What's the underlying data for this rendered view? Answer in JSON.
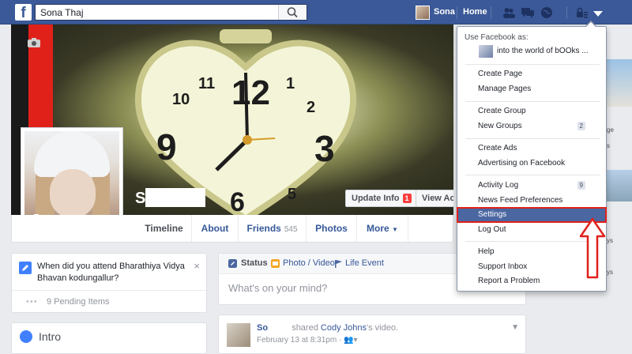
{
  "topbar": {
    "logo": "f",
    "search_value": "Sona Thaj",
    "profile_name": "Sona",
    "home_label": "Home"
  },
  "profile": {
    "name_initial": "S"
  },
  "cover_buttons": {
    "update_info": "Update Info",
    "update_info_badge": "1",
    "view_activity": "View Activi"
  },
  "tabs": [
    {
      "label": "Timeline"
    },
    {
      "label": "About"
    },
    {
      "label": "Friends",
      "count": "545"
    },
    {
      "label": "Photos"
    },
    {
      "label": "More"
    }
  ],
  "reminder": {
    "text": "When did you attend Bharathiya Vidya Bhavan kodungallur?",
    "pending": "9 Pending Items",
    "close": "×"
  },
  "intro": {
    "label": "Intro"
  },
  "composer": {
    "status": "Status",
    "photo_video": "Photo / Video",
    "life_event": "Life Event",
    "placeholder": "What's on your mind?"
  },
  "post": {
    "author": "So",
    "action": "shared",
    "shared_from": "Cody Johns",
    "object": "'s video.",
    "date": "February 13 at 8:31pm ·"
  },
  "right_peek": {
    "texts": [
      "ge",
      "s",
      "ys",
      "ys"
    ]
  },
  "dropdown": {
    "use_as": "Use Facebook as:",
    "page_name": "into the world of bOOks ...",
    "items": [
      {
        "label": "Create Page"
      },
      {
        "label": "Manage Pages"
      },
      {
        "label": "Create Group"
      },
      {
        "label": "New Groups",
        "badge": "2"
      },
      {
        "label": "Create Ads"
      },
      {
        "label": "Advertising on Facebook"
      },
      {
        "label": "Activity Log",
        "badge": "9"
      },
      {
        "label": "News Feed Preferences"
      },
      {
        "label": "Settings"
      },
      {
        "label": "Log Out"
      },
      {
        "label": "Help"
      },
      {
        "label": "Support Inbox"
      },
      {
        "label": "Report a Problem"
      }
    ]
  },
  "colors": {
    "brand": "#3b5998",
    "highlight": "#4b67a1",
    "annotation_red": "#e0211a"
  }
}
